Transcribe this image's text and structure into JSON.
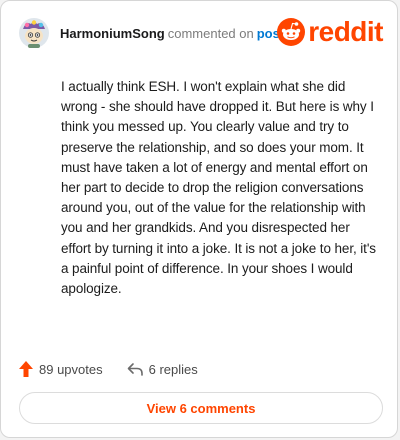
{
  "comment": {
    "username": "HarmoniumSong",
    "action": "commented on",
    "target": "post",
    "body": "I actually think ESH. I won't explain what she did wrong - she should have dropped it. But here is why I think you messed up. You clearly value and try to preserve the relationship, and so does your mom. It must have taken a lot of energy and mental effort on her part to decide to drop the religion conversations around you, out of the value for the relationship with you and her grandkids. And you disrespected her effort by turning it into a joke. It is not a joke to her, it's a painful point of difference. In your shoes I would apologize."
  },
  "brand": {
    "name": "reddit",
    "icon": "reddit-snoo-icon",
    "color": "#ff4500"
  },
  "stats": {
    "upvotes": "89 upvotes",
    "upvote_icon": "upvote-arrow-icon",
    "replies": "6 replies",
    "reply_icon": "reply-arrow-icon"
  },
  "actions": {
    "view_comments": "View 6 comments"
  },
  "colors": {
    "accent": "#ff4500",
    "link": "#0079d3"
  }
}
